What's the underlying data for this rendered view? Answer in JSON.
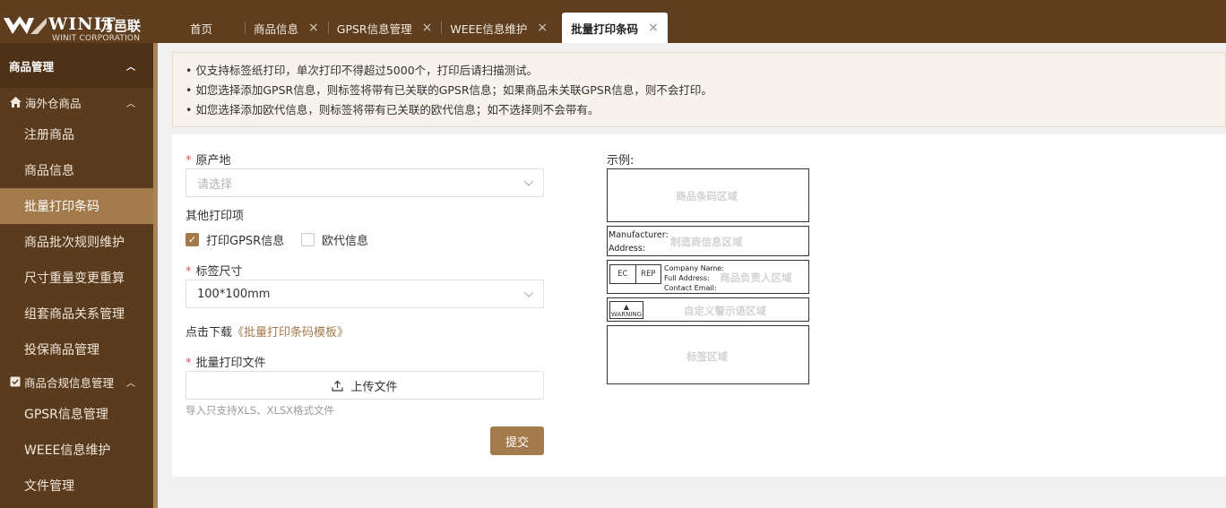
{
  "brand": {
    "name": "WINIT",
    "name_cn": "万邑联",
    "corp": "WINIT CORPORATION"
  },
  "tabs": [
    {
      "label": "首页",
      "closable": false
    },
    {
      "label": "商品信息",
      "closable": true
    },
    {
      "label": "GPSR信息管理",
      "closable": true
    },
    {
      "label": "WEEE信息维护",
      "closable": true
    },
    {
      "label": "批量打印条码",
      "closable": true,
      "active": true
    }
  ],
  "close_glyph": "×",
  "sidebar": {
    "group": "商品管理",
    "sections": [
      {
        "title": "海外仓商品",
        "icon": "home-icon",
        "items": [
          "注册商品",
          "商品信息",
          "批量打印条码",
          "商品批次规则维护",
          "尺寸重量变更重算",
          "组套商品关系管理",
          "投保商品管理"
        ]
      },
      {
        "title": "商品合规信息管理",
        "icon": "check-square-icon",
        "items": [
          "GPSR信息管理",
          "WEEE信息维护",
          "文件管理"
        ]
      }
    ],
    "active_item": "批量打印条码"
  },
  "notice": [
    "• 仅支持标签纸打印，单次打印不得超过5000个，打印后请扫描测试。",
    "• 如您选择添加GPSR信息，则标签将带有已关联的GPSR信息；如果商品未关联GPSR信息，则不会打印。",
    "• 如您选择添加欧代信息，则标签将带有已关联的欧代信息；如不选择则不会带有。"
  ],
  "form": {
    "origin_label": "原产地",
    "origin_placeholder": "请选择",
    "other_print_label": "其他打印项",
    "gpsr_check_label": "打印GPSR信息",
    "gpsr_checked": true,
    "eu_rep_label": "欧代信息",
    "eu_rep_checked": false,
    "size_label": "标签尺寸",
    "size_value": "100*100mm",
    "download_prefix": "点击下载",
    "download_link": "《批量打印条码模板》",
    "file_label": "批量打印文件",
    "upload_label": "上传文件",
    "upload_hint": "导入只支持XLS、XLSX格式文件",
    "submit_label": "提交",
    "required_mark": "*"
  },
  "example": {
    "title": "示例:",
    "barcode_area": "商品条码区域",
    "manufacturer_label": "Manufacturer:",
    "address_label": "Address:",
    "manufacturer_area": "制造商信息区域",
    "ec": "EC",
    "rep": "REP",
    "company_name": "Company Name:",
    "full_address": "Full Address:",
    "contact_email": "Contact Email:",
    "responsible_area": "商品负责人区域",
    "warning": "WARNING",
    "warning_area": "自定义警示语区域",
    "label_area": "标签区域"
  },
  "colors": {
    "header": "#5e3e1f",
    "sidebar": "#5a3b1d",
    "accent": "#a27a4c"
  }
}
